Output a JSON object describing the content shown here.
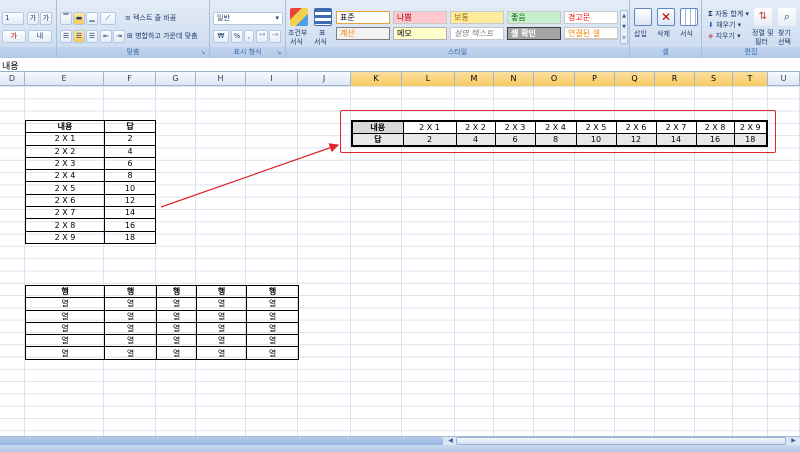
{
  "ribbon": {
    "font_group": {
      "font_size": "1",
      "grow_icon": "가",
      "shrink_icon": "가",
      "font_color_icon": "가",
      "hangul_icon": "내"
    },
    "alignment_group": {
      "wrap_text_label": "텍스트 줄 바꿈",
      "merge_center_label": "병합하고 가운데 맞춤",
      "group_label": "맞춤"
    },
    "number_group": {
      "format_value": "일반",
      "currency_label": "₩",
      "percent_label": "%",
      "comma_label": ",",
      "group_label": "표시 형식"
    },
    "styles_group": {
      "conditional_label_1": "조건부",
      "conditional_label_2": "서식",
      "table_label_1": "표",
      "table_label_2": "서식",
      "cells": [
        {
          "label": "표준",
          "bg": "#ffffff",
          "color": "#000000",
          "border": "#e6a23c"
        },
        {
          "label": "나쁨",
          "bg": "#ffc7ce",
          "color": "#9c0006",
          "border": "#c8c8c8"
        },
        {
          "label": "보통",
          "bg": "#ffeb9c",
          "color": "#9c6500",
          "border": "#c8c8c8"
        },
        {
          "label": "좋음",
          "bg": "#c6efce",
          "color": "#006100",
          "border": "#c8c8c8"
        },
        {
          "label": "경고문",
          "bg": "#ffffff",
          "color": "#ff0000",
          "border": "#c8c8c8"
        },
        {
          "label": "계산",
          "bg": "#f2f2f2",
          "color": "#fa7d00",
          "border": "#7f7f7f"
        },
        {
          "label": "메모",
          "bg": "#ffffcc",
          "color": "#000000",
          "border": "#b2b2b2"
        },
        {
          "label": "설명 텍스트",
          "bg": "#ffffff",
          "color": "#7f7f7f",
          "border": "#c8c8c8"
        },
        {
          "label": "셀 확인",
          "bg": "#a5a5a5",
          "color": "#ffffff",
          "border": "#3f3f3f"
        },
        {
          "label": "연결된 셀",
          "bg": "#ffffff",
          "color": "#fa7d00",
          "border": "#c8c8c8"
        }
      ],
      "group_label": "스타일"
    },
    "cells_group": {
      "insert_label": "삽입",
      "delete_label": "삭제",
      "format_label": "서식",
      "group_label": "셀"
    },
    "editing_group": {
      "autosum_label": "자동 합계",
      "fill_label": "채우기",
      "clear_label": "지우기",
      "sort_label_1": "정렬 및",
      "sort_label_2": "필터",
      "find_label_1": "찾기",
      "find_label_2": "선택",
      "group_label": "편집"
    }
  },
  "formula_bar": {
    "value": "내용"
  },
  "columns": [
    "D",
    "E",
    "F",
    "G",
    "H",
    "I",
    "J",
    "K",
    "L",
    "M",
    "N",
    "O",
    "P",
    "Q",
    "R",
    "S",
    "T",
    "U"
  ],
  "selected_columns": [
    "K",
    "L",
    "M",
    "N",
    "O",
    "P",
    "Q",
    "R",
    "S",
    "T"
  ],
  "table1": {
    "headers": [
      "내용",
      "답"
    ],
    "rows": [
      [
        "2 X 1",
        "2"
      ],
      [
        "2 X 2",
        "4"
      ],
      [
        "2 X 3",
        "6"
      ],
      [
        "2 X 4",
        "8"
      ],
      [
        "2 X 5",
        "10"
      ],
      [
        "2 X 6",
        "12"
      ],
      [
        "2 X 7",
        "14"
      ],
      [
        "2 X 8",
        "16"
      ],
      [
        "2 X 9",
        "18"
      ]
    ]
  },
  "table2": {
    "row1": [
      "내용",
      "2 X 1",
      "2 X 2",
      "2 X 3",
      "2 X 4",
      "2 X 5",
      "2 X 6",
      "2 X 7",
      "2 X 8",
      "2 X 9"
    ],
    "row2": [
      "답",
      "2",
      "4",
      "6",
      "8",
      "10",
      "12",
      "14",
      "16",
      "18"
    ]
  },
  "table3": {
    "headers": [
      "행",
      "행",
      "행",
      "행",
      "행"
    ],
    "rows": [
      [
        "열",
        "열",
        "열",
        "열",
        "열"
      ],
      [
        "열",
        "열",
        "열",
        "열",
        "열"
      ],
      [
        "열",
        "열",
        "열",
        "열",
        "열"
      ],
      [
        "열",
        "열",
        "열",
        "열",
        "열"
      ],
      [
        "열",
        "열",
        "열",
        "열",
        "열"
      ]
    ]
  },
  "colors": {
    "highlight_box": "#e0252b",
    "arrow": "#e0252b",
    "selected_column_header": "#f9c95f"
  }
}
